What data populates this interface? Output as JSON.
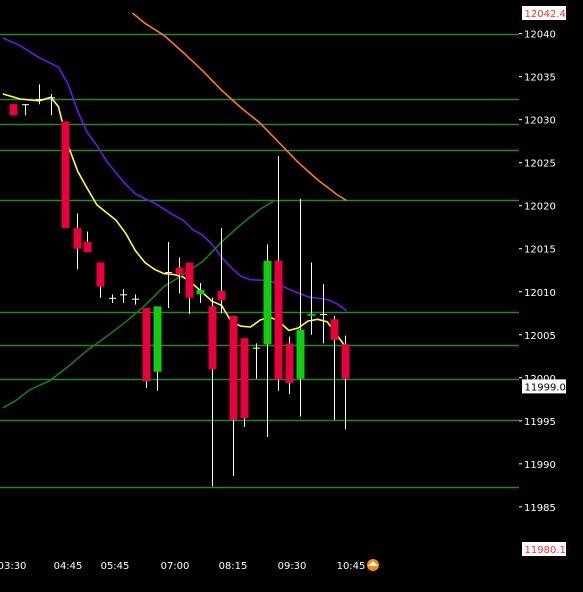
{
  "chart_data": {
    "type": "candlestick",
    "price_axis_labels": [
      "12040",
      "12035",
      "12030",
      "12025",
      "12020",
      "12015",
      "12010",
      "12005",
      "12000",
      "11995",
      "11990",
      "11985"
    ],
    "time_axis_labels": [
      "03:30",
      "04:45",
      "05:45",
      "07:00",
      "08:15",
      "09:30",
      "10:45"
    ],
    "price_tags": {
      "upper": {
        "text": "12042.4",
        "value": 12042.4,
        "color": "#ff3030"
      },
      "current": {
        "text": "11999.0",
        "value": 11999.0,
        "color": "#000000"
      },
      "lower": {
        "text": "11980.1",
        "value": 11980.1,
        "color": "#ff3030"
      }
    },
    "ylim": [
      11980.1,
      12042.4
    ],
    "colors": {
      "background": "#000000",
      "level_lines": "#1f8a1f",
      "up_candle": "#11cc11",
      "down_candle": "#e8003d",
      "wick": "#ffffff",
      "ma_yellow": "#ffff33",
      "ma_purple": "#6b17e6",
      "ma_orange": "#ff7a1a",
      "ma_green": "#1a7a1a",
      "axis_text": "#ffffff"
    },
    "horizontal_levels": [
      12040.0,
      12032.4,
      12029.5,
      12026.5,
      12020.7,
      12007.6,
      12003.8,
      11999.9,
      11995.1,
      11987.3
    ],
    "candles": [
      {
        "slot": 0.25,
        "o": 12031.8,
        "h": 12031.8,
        "l": 12030.5,
        "c": 12030.5
      },
      {
        "slot": 1.5,
        "o": 12031.8,
        "h": 12031.8,
        "l": 12030.5,
        "c": 12031.8
      },
      {
        "slot": 2.95,
        "o": 12032.4,
        "h": 12034.1,
        "l": 12031.8,
        "c": 12032.4
      },
      {
        "slot": 4.25,
        "o": 12032.6,
        "h": 12033.0,
        "l": 12030.5,
        "c": 12032.6
      },
      {
        "slot": 5.7,
        "o": 12029.8,
        "h": 12029.8,
        "l": 12017.4,
        "c": 12017.4
      },
      {
        "slot": 6.9,
        "o": 12017.4,
        "h": 12019.1,
        "l": 12012.6,
        "c": 12015.0
      },
      {
        "slot": 7.95,
        "o": 12015.8,
        "h": 12017.0,
        "l": 12014.6,
        "c": 12014.6
      },
      {
        "slot": 9.3,
        "o": 12013.4,
        "h": 12013.4,
        "l": 12009.3,
        "c": 12010.6
      },
      {
        "slot": 10.55,
        "o": 12009.3,
        "h": 12009.7,
        "l": 12008.7,
        "c": 12009.3
      },
      {
        "slot": 11.75,
        "o": 12009.7,
        "h": 12010.3,
        "l": 12008.7,
        "c": 12009.7
      },
      {
        "slot": 12.95,
        "o": 12009.2,
        "h": 12009.7,
        "l": 12008.5,
        "c": 12009.2
      },
      {
        "slot": 14.1,
        "o": 12008.1,
        "h": 12008.1,
        "l": 11998.8,
        "c": 11999.6
      },
      {
        "slot": 15.3,
        "o": 12000.7,
        "h": 12008.3,
        "l": 11998.5,
        "c": 12008.3
      },
      {
        "slot": 16.4,
        "o": 12012.3,
        "h": 12015.8,
        "l": 12008.1,
        "c": 12012.3
      },
      {
        "slot": 17.55,
        "o": 12012.8,
        "h": 12014.0,
        "l": 12009.8,
        "c": 12012.0
      },
      {
        "slot": 18.6,
        "o": 12013.4,
        "h": 12013.4,
        "l": 12007.4,
        "c": 12009.3
      },
      {
        "slot": 19.75,
        "o": 12009.7,
        "h": 12011.0,
        "l": 12008.7,
        "c": 12010.2
      },
      {
        "slot": 20.95,
        "o": 12008.3,
        "h": 12009.3,
        "l": 11987.4,
        "c": 12001.0
      },
      {
        "slot": 21.95,
        "o": 12010.1,
        "h": 12017.4,
        "l": 12007.5,
        "c": 12009.0
      },
      {
        "slot": 23.2,
        "o": 12007.2,
        "h": 12007.2,
        "l": 11988.6,
        "c": 11995.1
      },
      {
        "slot": 24.35,
        "o": 12004.6,
        "h": 12004.6,
        "l": 11994.3,
        "c": 11995.3
      },
      {
        "slot": 25.55,
        "o": 12003.5,
        "h": 12004.0,
        "l": 11999.9,
        "c": 12003.5
      },
      {
        "slot": 26.75,
        "o": 12003.9,
        "h": 12015.5,
        "l": 11993.1,
        "c": 12013.6
      },
      {
        "slot": 27.85,
        "o": 12013.6,
        "h": 12025.8,
        "l": 11998.5,
        "c": 11999.8
      },
      {
        "slot": 29.05,
        "o": 12004.0,
        "h": 12004.8,
        "l": 11998.1,
        "c": 11999.4
      },
      {
        "slot": 30.2,
        "o": 11999.9,
        "h": 12020.8,
        "l": 11995.5,
        "c": 12005.6
      },
      {
        "slot": 31.3,
        "o": 12007.2,
        "h": 12013.4,
        "l": 12005.0,
        "c": 12007.4
      },
      {
        "slot": 32.5,
        "o": 12007.4,
        "h": 12010.9,
        "l": 12004.0,
        "c": 12007.4
      },
      {
        "slot": 33.7,
        "o": 12006.8,
        "h": 12007.2,
        "l": 11995.1,
        "c": 12004.4
      },
      {
        "slot": 34.85,
        "o": 12003.9,
        "h": 12004.9,
        "l": 11994.0,
        "c": 11999.9
      }
    ],
    "moving_averages": [
      {
        "color": "#6b17e6",
        "points": [
          [
            -0.8,
            12039.5
          ],
          [
            1,
            12038.6
          ],
          [
            3,
            12037.2
          ],
          [
            5,
            12036.1
          ],
          [
            6,
            12034.1
          ],
          [
            7,
            12031.0
          ],
          [
            8,
            12028.5
          ],
          [
            9,
            12027.0
          ],
          [
            10,
            12025.2
          ],
          [
            11,
            12023.8
          ],
          [
            12,
            12022.5
          ],
          [
            13,
            12021.4
          ],
          [
            14,
            12020.8
          ],
          [
            15,
            12020.3
          ],
          [
            16,
            12019.6
          ],
          [
            17,
            12018.9
          ],
          [
            18,
            12018.3
          ],
          [
            19,
            12017.2
          ],
          [
            20,
            12016.6
          ],
          [
            21,
            12015.5
          ],
          [
            22,
            12014.0
          ],
          [
            23,
            12012.8
          ],
          [
            24,
            12011.8
          ],
          [
            25,
            12011.4
          ],
          [
            27,
            12011.3
          ],
          [
            29,
            12010.3
          ],
          [
            31,
            12009.4
          ],
          [
            33,
            12009.1
          ],
          [
            34,
            12008.6
          ],
          [
            35,
            12007.8
          ]
        ]
      },
      {
        "color": "#ffff33",
        "points": [
          [
            -0.8,
            12033.0
          ],
          [
            1,
            12032.4
          ],
          [
            3,
            12032.2
          ],
          [
            4.2,
            12032.6
          ],
          [
            5,
            12031.5
          ],
          [
            6,
            12027.0
          ],
          [
            7,
            12024.0
          ],
          [
            8,
            12022.0
          ],
          [
            9,
            12020.1
          ],
          [
            10,
            12019.2
          ],
          [
            11,
            12018.3
          ],
          [
            12,
            12016.8
          ],
          [
            13,
            12014.8
          ],
          [
            14,
            12013.4
          ],
          [
            15,
            12012.6
          ],
          [
            16,
            12012.1
          ],
          [
            17,
            12012.0
          ],
          [
            18,
            12011.7
          ],
          [
            19,
            12010.9
          ],
          [
            20,
            12009.9
          ],
          [
            21,
            12008.9
          ],
          [
            22,
            12008.4
          ],
          [
            23,
            12006.5
          ],
          [
            24,
            12006.0
          ],
          [
            25,
            12005.9
          ],
          [
            26,
            12006.7
          ],
          [
            27,
            12007.1
          ],
          [
            28,
            12006.5
          ],
          [
            29,
            12005.5
          ],
          [
            30,
            12005.8
          ],
          [
            31,
            12006.6
          ],
          [
            32,
            12006.8
          ],
          [
            33,
            12006.5
          ],
          [
            34,
            12005.0
          ],
          [
            35,
            12003.4
          ]
        ]
      },
      {
        "color": "#1a7a1a",
        "points": [
          [
            -0.8,
            11996.5
          ],
          [
            0.5,
            11997.3
          ],
          [
            2,
            11998.6
          ],
          [
            4,
            11999.6
          ],
          [
            6,
            12001.3
          ],
          [
            8,
            12003.2
          ],
          [
            10,
            12004.8
          ],
          [
            12,
            12006.5
          ],
          [
            14,
            12008.4
          ],
          [
            16,
            12010.6
          ],
          [
            18,
            12012.0
          ],
          [
            20,
            12013.5
          ],
          [
            22,
            12015.8
          ],
          [
            24,
            12017.8
          ],
          [
            26,
            12019.6
          ],
          [
            27.5,
            12020.6
          ]
        ]
      },
      {
        "color": "#ff7a1a",
        "points": [
          [
            12.7,
            12042.4
          ],
          [
            14,
            12041.2
          ],
          [
            16,
            12039.8
          ],
          [
            18,
            12037.8
          ],
          [
            20,
            12035.7
          ],
          [
            22,
            12033.4
          ],
          [
            24,
            12031.4
          ],
          [
            26,
            12029.6
          ],
          [
            28,
            12027.3
          ],
          [
            30,
            12025.0
          ],
          [
            32,
            12023.0
          ],
          [
            34,
            12021.3
          ],
          [
            35,
            12020.6
          ]
        ]
      }
    ]
  }
}
